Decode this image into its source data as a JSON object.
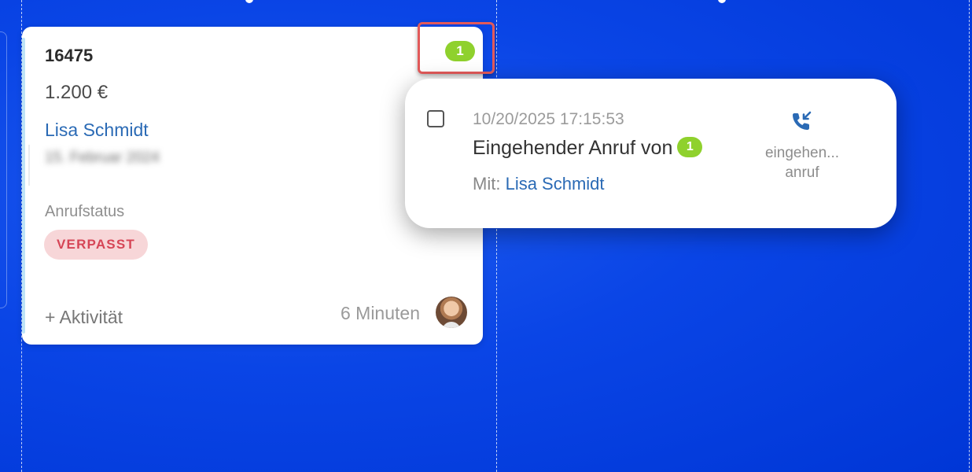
{
  "card": {
    "id": "16475",
    "amount": "1.200 €",
    "contact": "Lisa Schmidt",
    "date": "15. Februar 2024",
    "status_label": "Anrufstatus",
    "status_badge": "VERPASST",
    "add_activity": "+ Aktivität",
    "time_ago": "6 Minuten",
    "notification_count": "1"
  },
  "popup": {
    "timestamp": "10/20/2025 17:15:53",
    "title": "Eingehender Anruf von",
    "count": "1",
    "with_label": "Mit:",
    "with_name": "Lisa Schmidt",
    "call_type_line1": "eingehen...",
    "call_type_line2": "anruf",
    "icon": "incoming-call-icon"
  },
  "colors": {
    "background": "#0a45e6",
    "accent_blue": "#2a6ab5",
    "badge_green": "#8fd12d",
    "missed_red": "#d64556",
    "highlight_red": "#e25a5a"
  }
}
